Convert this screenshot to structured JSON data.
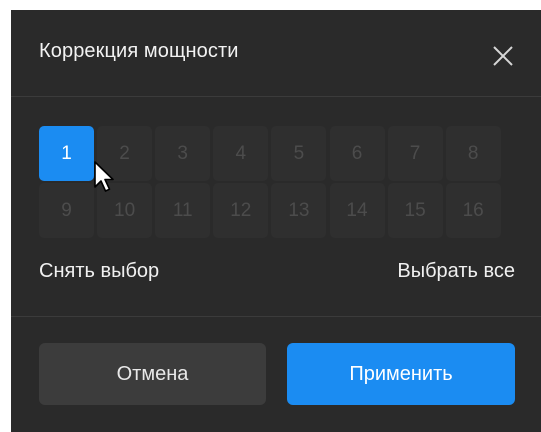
{
  "dialog": {
    "title": "Коррекция мощности",
    "close_icon": "close-icon"
  },
  "channels": {
    "items": [
      {
        "label": "1",
        "selected": true
      },
      {
        "label": "2",
        "selected": false
      },
      {
        "label": "3",
        "selected": false
      },
      {
        "label": "4",
        "selected": false
      },
      {
        "label": "5",
        "selected": false
      },
      {
        "label": "6",
        "selected": false
      },
      {
        "label": "7",
        "selected": false
      },
      {
        "label": "8",
        "selected": false
      },
      {
        "label": "9",
        "selected": false
      },
      {
        "label": "10",
        "selected": false
      },
      {
        "label": "11",
        "selected": false
      },
      {
        "label": "12",
        "selected": false
      },
      {
        "label": "13",
        "selected": false
      },
      {
        "label": "14",
        "selected": false
      },
      {
        "label": "15",
        "selected": false
      },
      {
        "label": "16",
        "selected": false
      }
    ]
  },
  "selection": {
    "deselect_label": "Снять выбор",
    "select_all_label": "Выбрать все"
  },
  "footer": {
    "cancel_label": "Отмена",
    "apply_label": "Применить"
  },
  "colors": {
    "dialog_background": "#2a2a2a",
    "accent": "#1b8cf2",
    "channel_inactive": "#2f2f2f",
    "channel_inactive_text": "#4c4c4c",
    "cancel_background": "#3c3c3c"
  }
}
